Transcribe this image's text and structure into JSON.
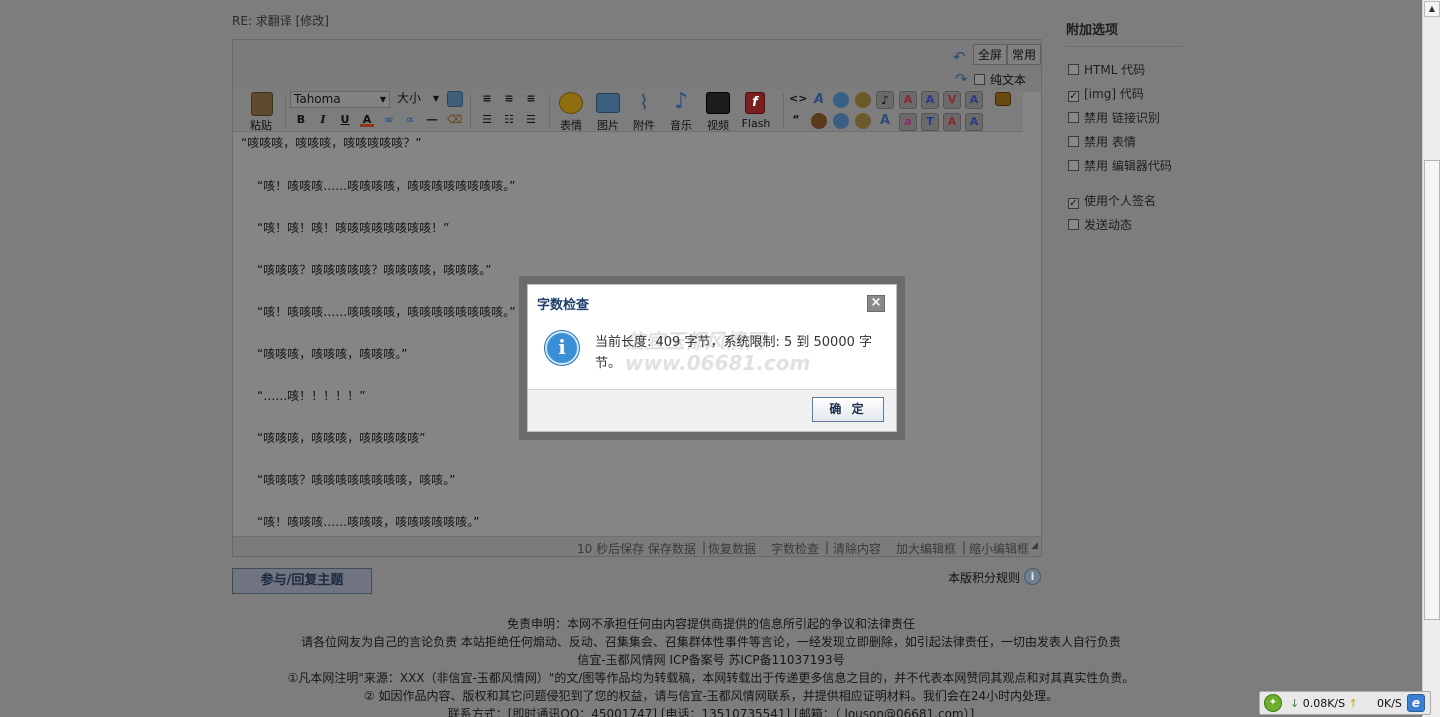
{
  "post": {
    "subject": "RE: 求翻译 [修改]"
  },
  "editor_toolbar": {
    "fullscreen": "全屏",
    "common": "常用",
    "plain_text": "纯文本",
    "paste": "粘贴",
    "font_name": "Tahoma",
    "font_size": "大小",
    "emoticon": "表情",
    "image": "图片",
    "attachment": "附件",
    "music": "音乐",
    "video": "视频",
    "flash": "Flash"
  },
  "editor_content": [
    "“咳咳咳，咳咳咳，咳咳咳咳咳？”",
    "“咳！咳咳咳……咳咳咳咳，咳咳咳咳咳咳咳咳。”",
    "“咳！咳！咳！咳咳咳咳咳咳咳咳！”",
    "“咳咳咳？咳咳咳咳咳？咳咳咳咳，咳咳咳。”",
    "“咳！咳咳咳……咳咳咳咳，咳咳咳咳咳咳咳咳。”",
    "“咳咳咳，咳咳咳，咳咳咳。”",
    "“……咳！！！！！”",
    "“咳咳咳，咳咳咳，咳咳咳咳咳”",
    "“咳咳咳？咳咳咳咳咳咳咳咳，咳咳。”",
    "“咳！咳咳咳……咳咳咳，咳咳咳咳咳咳。”"
  ],
  "editor_status": {
    "autosave": "10 秒后保存 保存数据",
    "restore": "恢复数据",
    "word_check": "字数检查",
    "clear": "清除内容",
    "enlarge": "加大编辑框",
    "shrink": "缩小编辑框"
  },
  "submit_label": "参与/回复主题",
  "rules_label": "本版积分规则",
  "sidebar": {
    "title": "附加选项",
    "options": [
      {
        "label": "HTML 代码",
        "checked": false
      },
      {
        "label": "[img] 代码",
        "checked": true
      },
      {
        "label": "禁用 链接识别",
        "checked": false
      },
      {
        "label": "禁用 表情",
        "checked": false
      },
      {
        "label": "禁用 编辑器代码",
        "checked": false
      },
      {
        "label": "使用个人签名",
        "checked": true
      },
      {
        "label": "发送动态",
        "checked": false
      }
    ]
  },
  "footer": {
    "line1": "免责申明：本网不承担任何由内容提供商提供的信息所引起的争议和法律责任",
    "line2": "请各位网友为自己的言论负责 本站拒绝任何煽动、反动、召集集会、召集群体性事件等言论，一经发现立即删除，如引起法律责任，一切由发表人自行负责",
    "line3": "信宜-玉都风情网 ICP备案号 苏ICP备11037193号",
    "line4": "①凡本网注明\"来源：XXX（非信宜-玉都风情网）\"的文/图等作品均为转载稿，本网转载出于传递更多信息之目的，并不代表本网赞同其观点和对其真实性负责。",
    "line5": "② 如因作品内容、版权和其它问题侵犯到了您的权益，请与信宜-玉都风情网联系，并提供相应证明材料。我们会在24小时内处理。",
    "line6": "联系方式：[即时通讯QQ：45001747] [电话：13510735541] [邮箱：（ louson@06681.com）]"
  },
  "dialog": {
    "title": "字数检查",
    "message_line1": "当前长度: 409 字节，系统限制: 5 到 50000 字",
    "message_line2": "节。",
    "ok_label": "确 定",
    "watermark": "信宜玉都风情网 www.06681.com"
  },
  "tray": {
    "download": "0.08K/S",
    "upload": "0K/S"
  }
}
